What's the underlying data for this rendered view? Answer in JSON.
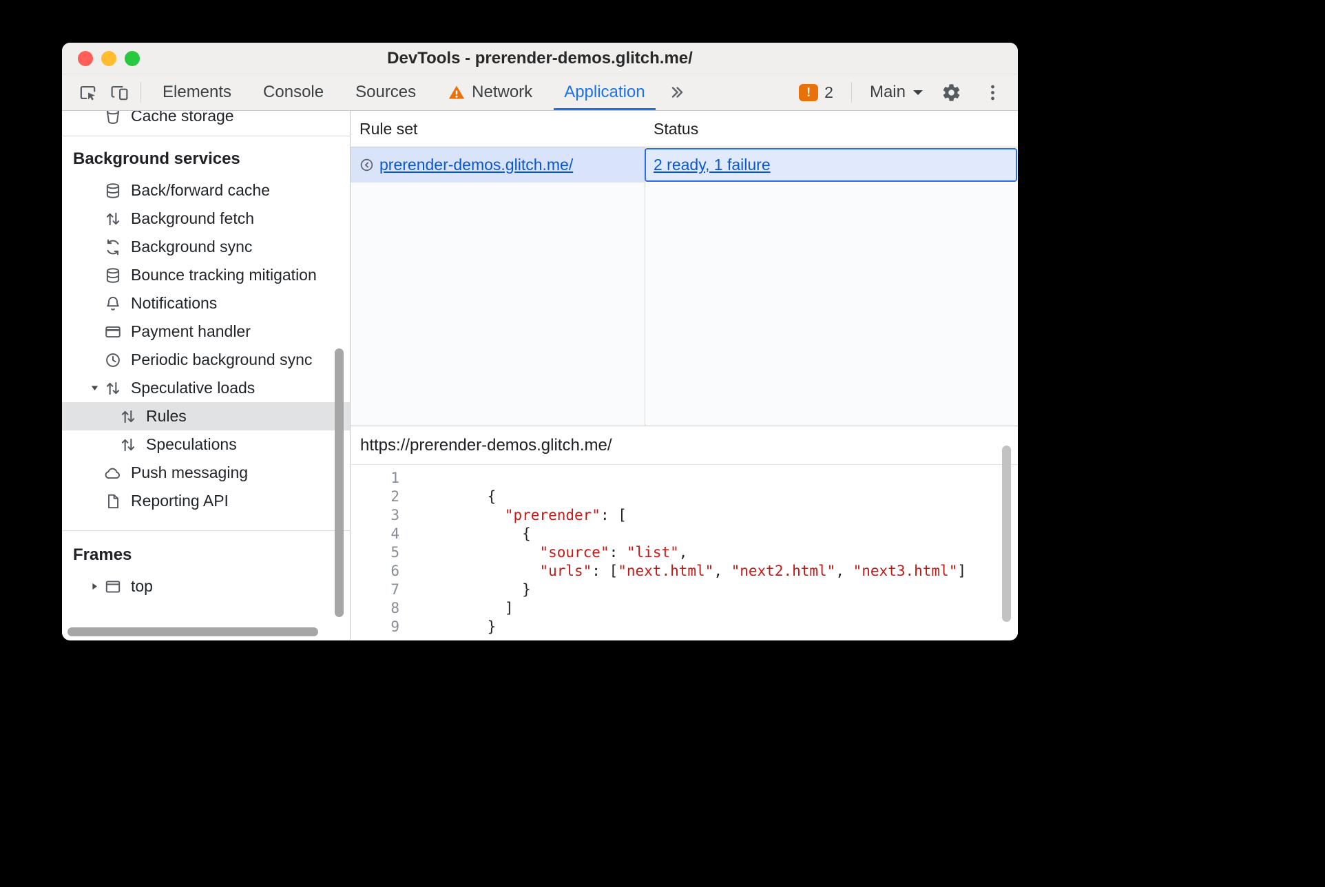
{
  "window": {
    "title": "DevTools - prerender-demos.glitch.me/"
  },
  "toolbar": {
    "tabs": [
      {
        "label": "Elements"
      },
      {
        "label": "Console"
      },
      {
        "label": "Sources"
      },
      {
        "label": "Network",
        "warning": true
      },
      {
        "label": "Application"
      }
    ],
    "active_tab": "Application",
    "more_tabs_icon": "chevrons-right-icon",
    "issues": {
      "count": "2"
    },
    "target_selector": {
      "label": "Main"
    }
  },
  "sidebar": {
    "scrolled_item": {
      "label": "Cache storage",
      "icon": "bucket-icon"
    },
    "sections": [
      {
        "title": "Background services",
        "items": [
          {
            "label": "Back/forward cache",
            "icon": "database-icon"
          },
          {
            "label": "Background fetch",
            "icon": "arrows-up-down-icon"
          },
          {
            "label": "Background sync",
            "icon": "sync-icon"
          },
          {
            "label": "Bounce tracking mitigation",
            "icon": "database-icon"
          },
          {
            "label": "Notifications",
            "icon": "bell-icon"
          },
          {
            "label": "Payment handler",
            "icon": "payment-card-icon"
          },
          {
            "label": "Periodic background sync",
            "icon": "clock-icon"
          },
          {
            "label": "Speculative loads",
            "icon": "arrows-up-down-icon",
            "disclosure": "expanded"
          },
          {
            "label": "Rules",
            "icon": "arrows-up-down-icon",
            "level": 2,
            "selected": true
          },
          {
            "label": "Speculations",
            "icon": "arrows-up-down-icon",
            "level": 2
          },
          {
            "label": "Push messaging",
            "icon": "cloud-icon"
          },
          {
            "label": "Reporting API",
            "icon": "document-icon"
          }
        ]
      },
      {
        "title": "Frames",
        "items": [
          {
            "label": "top",
            "icon": "frame-icon",
            "disclosure": "collapsed"
          }
        ]
      }
    ]
  },
  "grid": {
    "columns": [
      "Rule set",
      "Status"
    ],
    "rows": [
      {
        "rule_set": "prerender-demos.glitch.me/",
        "status": "2 ready, 1 failure",
        "icon": "rule-set-icon"
      }
    ]
  },
  "preview": {
    "url": "https://prerender-demos.glitch.me/",
    "code_lines": [
      {
        "num": "1",
        "segments": []
      },
      {
        "num": "2",
        "segments": [
          {
            "t": "    {",
            "y": "plain"
          }
        ]
      },
      {
        "num": "3",
        "segments": [
          {
            "t": "      ",
            "y": "plain"
          },
          {
            "t": "\"prerender\"",
            "y": "str"
          },
          {
            "t": ": [",
            "y": "plain"
          }
        ]
      },
      {
        "num": "4",
        "segments": [
          {
            "t": "        {",
            "y": "plain"
          }
        ]
      },
      {
        "num": "5",
        "segments": [
          {
            "t": "          ",
            "y": "plain"
          },
          {
            "t": "\"source\"",
            "y": "str"
          },
          {
            "t": ": ",
            "y": "plain"
          },
          {
            "t": "\"list\"",
            "y": "str"
          },
          {
            "t": ",",
            "y": "plain"
          }
        ]
      },
      {
        "num": "6",
        "segments": [
          {
            "t": "          ",
            "y": "plain"
          },
          {
            "t": "\"urls\"",
            "y": "str"
          },
          {
            "t": ": [",
            "y": "plain"
          },
          {
            "t": "\"next.html\"",
            "y": "str"
          },
          {
            "t": ", ",
            "y": "plain"
          },
          {
            "t": "\"next2.html\"",
            "y": "str"
          },
          {
            "t": ", ",
            "y": "plain"
          },
          {
            "t": "\"next3.html\"",
            "y": "str"
          },
          {
            "t": "]",
            "y": "plain"
          }
        ]
      },
      {
        "num": "7",
        "segments": [
          {
            "t": "        }",
            "y": "plain"
          }
        ]
      },
      {
        "num": "8",
        "segments": [
          {
            "t": "      ]",
            "y": "plain"
          }
        ]
      },
      {
        "num": "9",
        "segments": [
          {
            "t": "    }",
            "y": "plain"
          }
        ]
      }
    ]
  },
  "colors": {
    "active_tab_blue": "#1a73e8",
    "link_blue": "#0b57d0",
    "warning_orange": "#e8710a",
    "code_string_red": "#c41a16",
    "selected_row_bg": "#d9e4fb",
    "focus_ring_blue": "#2b6de8"
  }
}
